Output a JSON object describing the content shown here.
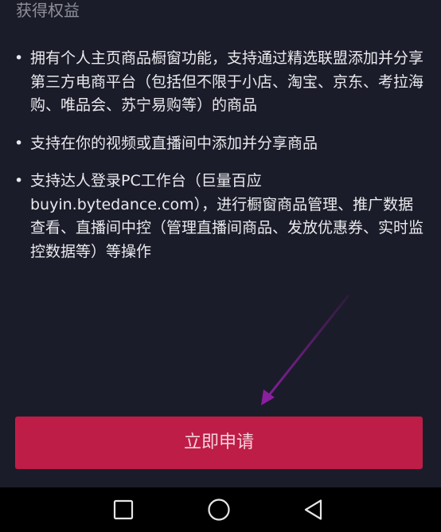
{
  "section": {
    "title": "获得权益"
  },
  "benefits": [
    {
      "bullet": "•",
      "text": "拥有个人主页商品橱窗功能，支持通过精选联盟添加并分享第三方电商平台（包括但不限于小店、淘宝、京东、考拉海购、唯品会、苏宁易购等）的商品"
    },
    {
      "bullet": "•",
      "text": "支持在你的视频或直播间中添加并分享商品"
    },
    {
      "bullet": "•",
      "text": "支持达人登录PC工作台（巨量百应 buyin.bytedance.com），进行橱窗商品管理、推广数据查看、直播间中控（管理直播间商品、发放优惠券、实时监控数据等）等操作"
    }
  ],
  "apply_button": {
    "label": "立即申请"
  },
  "nav_bar": {
    "recents_icon": "square-icon",
    "home_icon": "circle-icon",
    "back_icon": "triangle-back-icon"
  },
  "colors": {
    "background": "#1b1c29",
    "button": "#be1d47",
    "annotation_arrow": "#8a1fa0",
    "nav_bar": "#000000"
  }
}
